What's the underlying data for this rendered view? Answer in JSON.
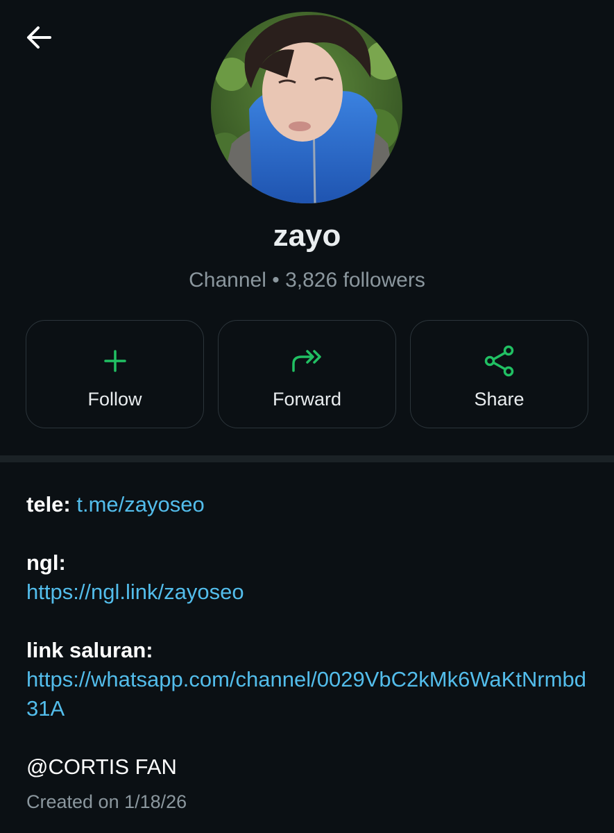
{
  "header": {
    "back_icon": "arrow-left-icon"
  },
  "profile": {
    "name": "zayo",
    "type": "Channel",
    "separator": "•",
    "followers": "3,826 followers"
  },
  "actions": [
    {
      "label": "Follow",
      "icon": "plus-icon"
    },
    {
      "label": "Forward",
      "icon": "forward-icon"
    },
    {
      "label": "Share",
      "icon": "share-icon"
    }
  ],
  "description": {
    "tele_label": "tele:",
    "tele_link": "t.me/zayoseo",
    "ngl_label": "ngl:",
    "ngl_link": "https://ngl.link/zayoseo",
    "saluran_label": "link saluran:",
    "saluran_link": "https://whatsapp.com/channel/0029VbC2kMk6WaKtNrmbd31A",
    "mention": "@CORTIS FAN"
  },
  "created": "Created on 1/18/26",
  "colors": {
    "background": "#0b1014",
    "accent_green": "#21c063",
    "link_blue": "#53bdeb",
    "muted_text": "#8b979e"
  }
}
